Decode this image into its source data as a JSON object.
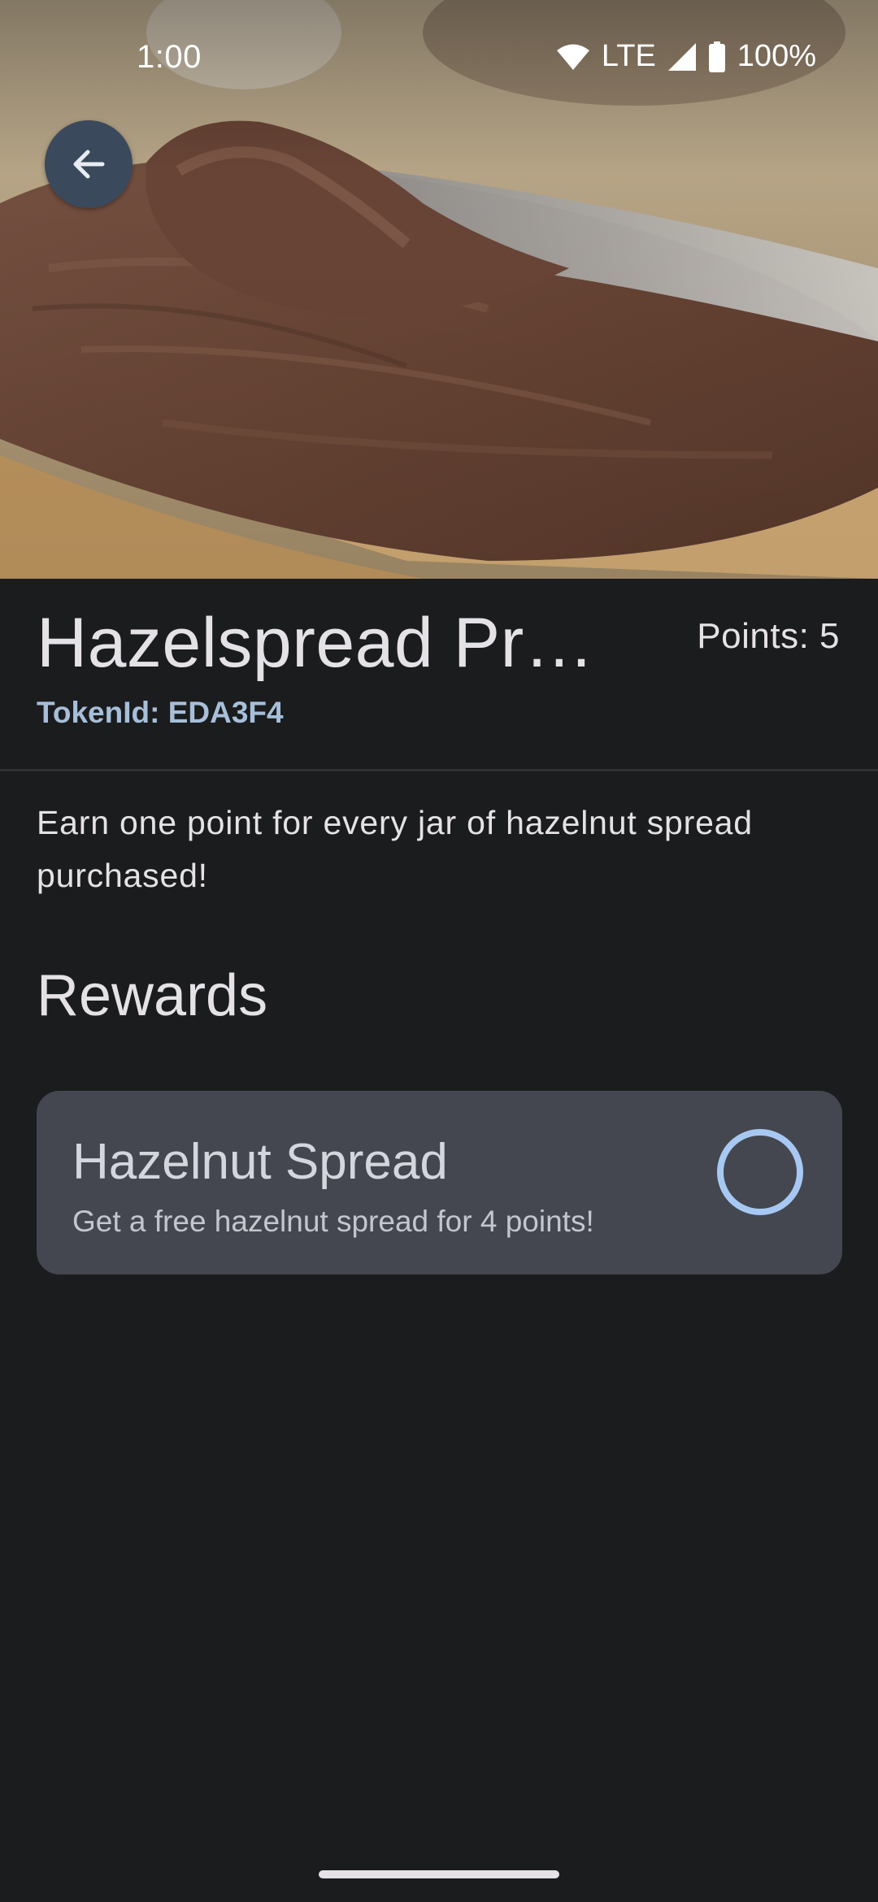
{
  "status_bar": {
    "time": "1:00",
    "network": "LTE",
    "battery": "100%",
    "icons": [
      "wifi-icon",
      "cell-signal-icon",
      "battery-icon"
    ]
  },
  "hero": {
    "image": "hazelnut-spread-on-toast-photo"
  },
  "header": {
    "back_icon": "arrow-left-icon",
    "title": "Hazelspread Pro...",
    "token_id": "TokenId: EDA3F4",
    "points": "Points: 5"
  },
  "description": "Earn one point for every jar of hazelnut spread purchased!",
  "rewards": {
    "heading": "Rewards",
    "items": [
      {
        "name": "Hazelnut Spread",
        "description": "Get a free hazelnut spread for 4 points!",
        "indicator_icon": "circle-progress-icon"
      }
    ]
  },
  "colors": {
    "background": "#1b1c1e",
    "accent": "#a7c8f2",
    "card": "#44474f",
    "token_text": "#a7bfd8",
    "back_button": "#3a4a5c"
  }
}
